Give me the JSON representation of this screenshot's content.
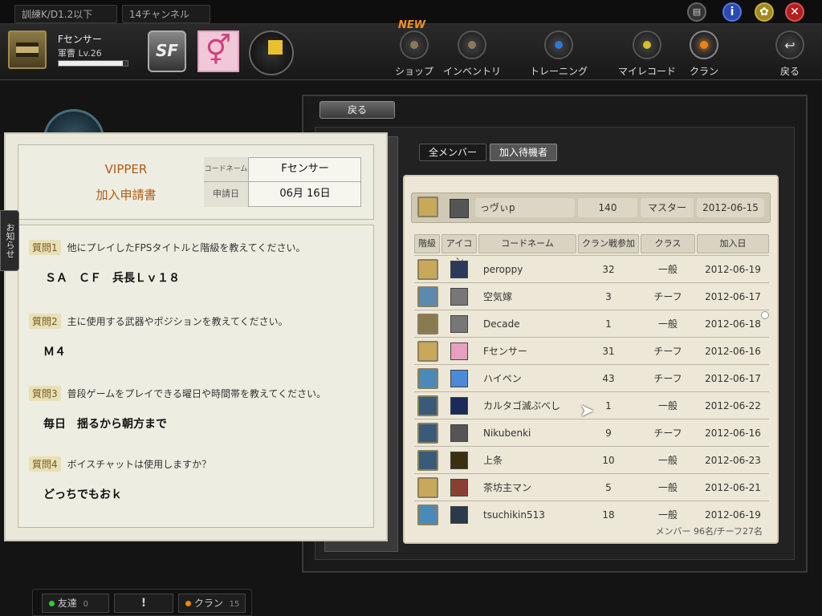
{
  "topbar": {
    "channel_filter": "訓練K/D1.2以下",
    "channel": "14チャンネル"
  },
  "player": {
    "name": "Fセンサー",
    "rank": "軍曹 Lv.26",
    "exp_fraction": 0.93
  },
  "nav": {
    "new_badge": "NEW",
    "shop": "ショップ",
    "inventory": "インベントリ",
    "training": "トレーニング",
    "myrecord": "マイレコード",
    "clan": "クラン",
    "back": "戻る"
  },
  "clan_window": {
    "back_tab": "戻る",
    "tabs": [
      "全メンバー",
      "加入待機者"
    ],
    "master": {
      "name": "っヴぃp",
      "count": "140",
      "class": "マスター",
      "date": "2012-06-15"
    },
    "headers": [
      "階級",
      "アイコン",
      "コードネーム",
      "クラン戦参加",
      "クラス",
      "加入日"
    ],
    "members": [
      {
        "name": "peroppy",
        "count": "32",
        "class": "一般",
        "date": "2012-06-19",
        "rank_color": "#c8a85a",
        "icon_color": "#2a3a5a"
      },
      {
        "name": "空気嫁",
        "count": "3",
        "class": "チーフ",
        "date": "2012-06-17",
        "rank_color": "#5a8ab0",
        "icon_color": "#777"
      },
      {
        "name": "Decade",
        "count": "1",
        "class": "一般",
        "date": "2012-06-18",
        "rank_color": "#8a7a50",
        "icon_color": "#777"
      },
      {
        "name": "Fセンサー",
        "count": "31",
        "class": "チーフ",
        "date": "2012-06-16",
        "rank_color": "#c8a85a",
        "icon_color": "#e8a0c0"
      },
      {
        "name": "ハイペン",
        "count": "43",
        "class": "チーフ",
        "date": "2012-06-17",
        "rank_color": "#4a8ab8",
        "icon_color": "#4a8ad8"
      },
      {
        "name": "カルタゴ滅ぶべし",
        "count": "1",
        "class": "一般",
        "date": "2012-06-22",
        "rank_color": "#3a5a7a",
        "icon_color": "#1a2a5a"
      },
      {
        "name": "Nikubenki",
        "count": "9",
        "class": "チーフ",
        "date": "2012-06-16",
        "rank_color": "#3a5a7a",
        "icon_color": "#555"
      },
      {
        "name": "上条",
        "count": "10",
        "class": "一般",
        "date": "2012-06-23",
        "rank_color": "#3a5a7a",
        "icon_color": "#3a3010"
      },
      {
        "name": "茶坊主マン",
        "count": "5",
        "class": "一般",
        "date": "2012-06-21",
        "rank_color": "#c8a85a",
        "icon_color": "#8a4030"
      },
      {
        "name": "tsuchikin513",
        "count": "18",
        "class": "一般",
        "date": "2012-06-19",
        "rank_color": "#4a8ab8",
        "icon_color": "#2a3a4a"
      }
    ],
    "footer": "メンバー 96名/チーフ27名"
  },
  "application": {
    "clan_name": "VIPPER",
    "form_title": "加入申請書",
    "codename_label": "コードネーム",
    "codename": "Fセンサー",
    "date_label": "申請日",
    "date": "06月 16日",
    "questions": [
      {
        "label": "質問1",
        "text": "他にプレイしたFPSタイトルと階級を教えてください。",
        "answer": "ＳＡ　ＣＦ　兵長Ｌｖ１８"
      },
      {
        "label": "質問2",
        "text": "主に使用する武器やポジションを教えてください。",
        "answer": "Ｍ４"
      },
      {
        "label": "質問3",
        "text": "普段ゲームをプレイできる曜日や時間帯を教えてください。",
        "answer": "毎日　揺るから朝方まで"
      },
      {
        "label": "質問4",
        "text": "ボイスチャットは使用しますか？",
        "answer": "どっちでもおｋ"
      }
    ]
  },
  "side_tab": "お知らせ",
  "bottombar": {
    "friends": "友達",
    "friends_count": "0",
    "alert": "!",
    "clan": "クラン",
    "clan_count": "15"
  },
  "colors": {
    "accent_orange": "#e07a10",
    "clan_title": "#b05a10"
  }
}
